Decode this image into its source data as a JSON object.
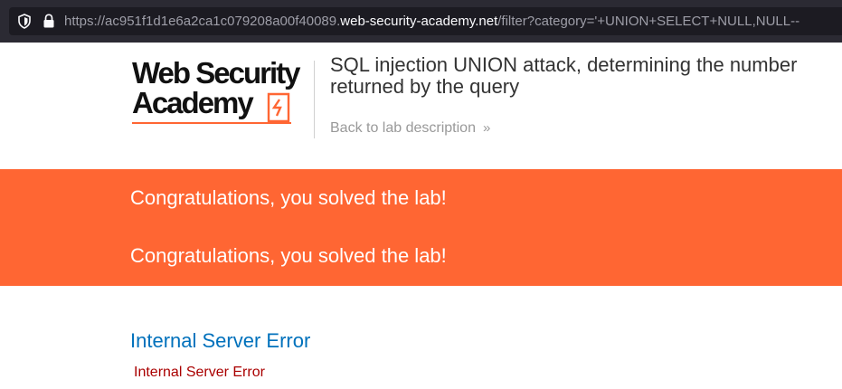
{
  "browser": {
    "url_prefix": "https://ac951f1d1e6a2ca1c079208a00f40089.",
    "url_host": "web-security-academy.net",
    "url_path": "/filter?category='+UNION+SELECT+NULL,NULL--",
    "icons": [
      "shield-icon",
      "lock-icon"
    ]
  },
  "logo": {
    "line1": "Web Security",
    "line2": "Academy",
    "accent_color": "#ff6633"
  },
  "header": {
    "title_line1": "SQL injection UNION attack, determining the number",
    "title_line2": "returned by the query",
    "back_link": "Back to lab description"
  },
  "banner": {
    "color": "#ff6633",
    "messages": [
      "Congratulations, you solved the lab!",
      "Congratulations, you solved the lab!"
    ]
  },
  "error": {
    "heading": "Internal Server Error",
    "message": "Internal Server Error",
    "heading_color": "#0071bc",
    "message_color": "#aa0000"
  }
}
